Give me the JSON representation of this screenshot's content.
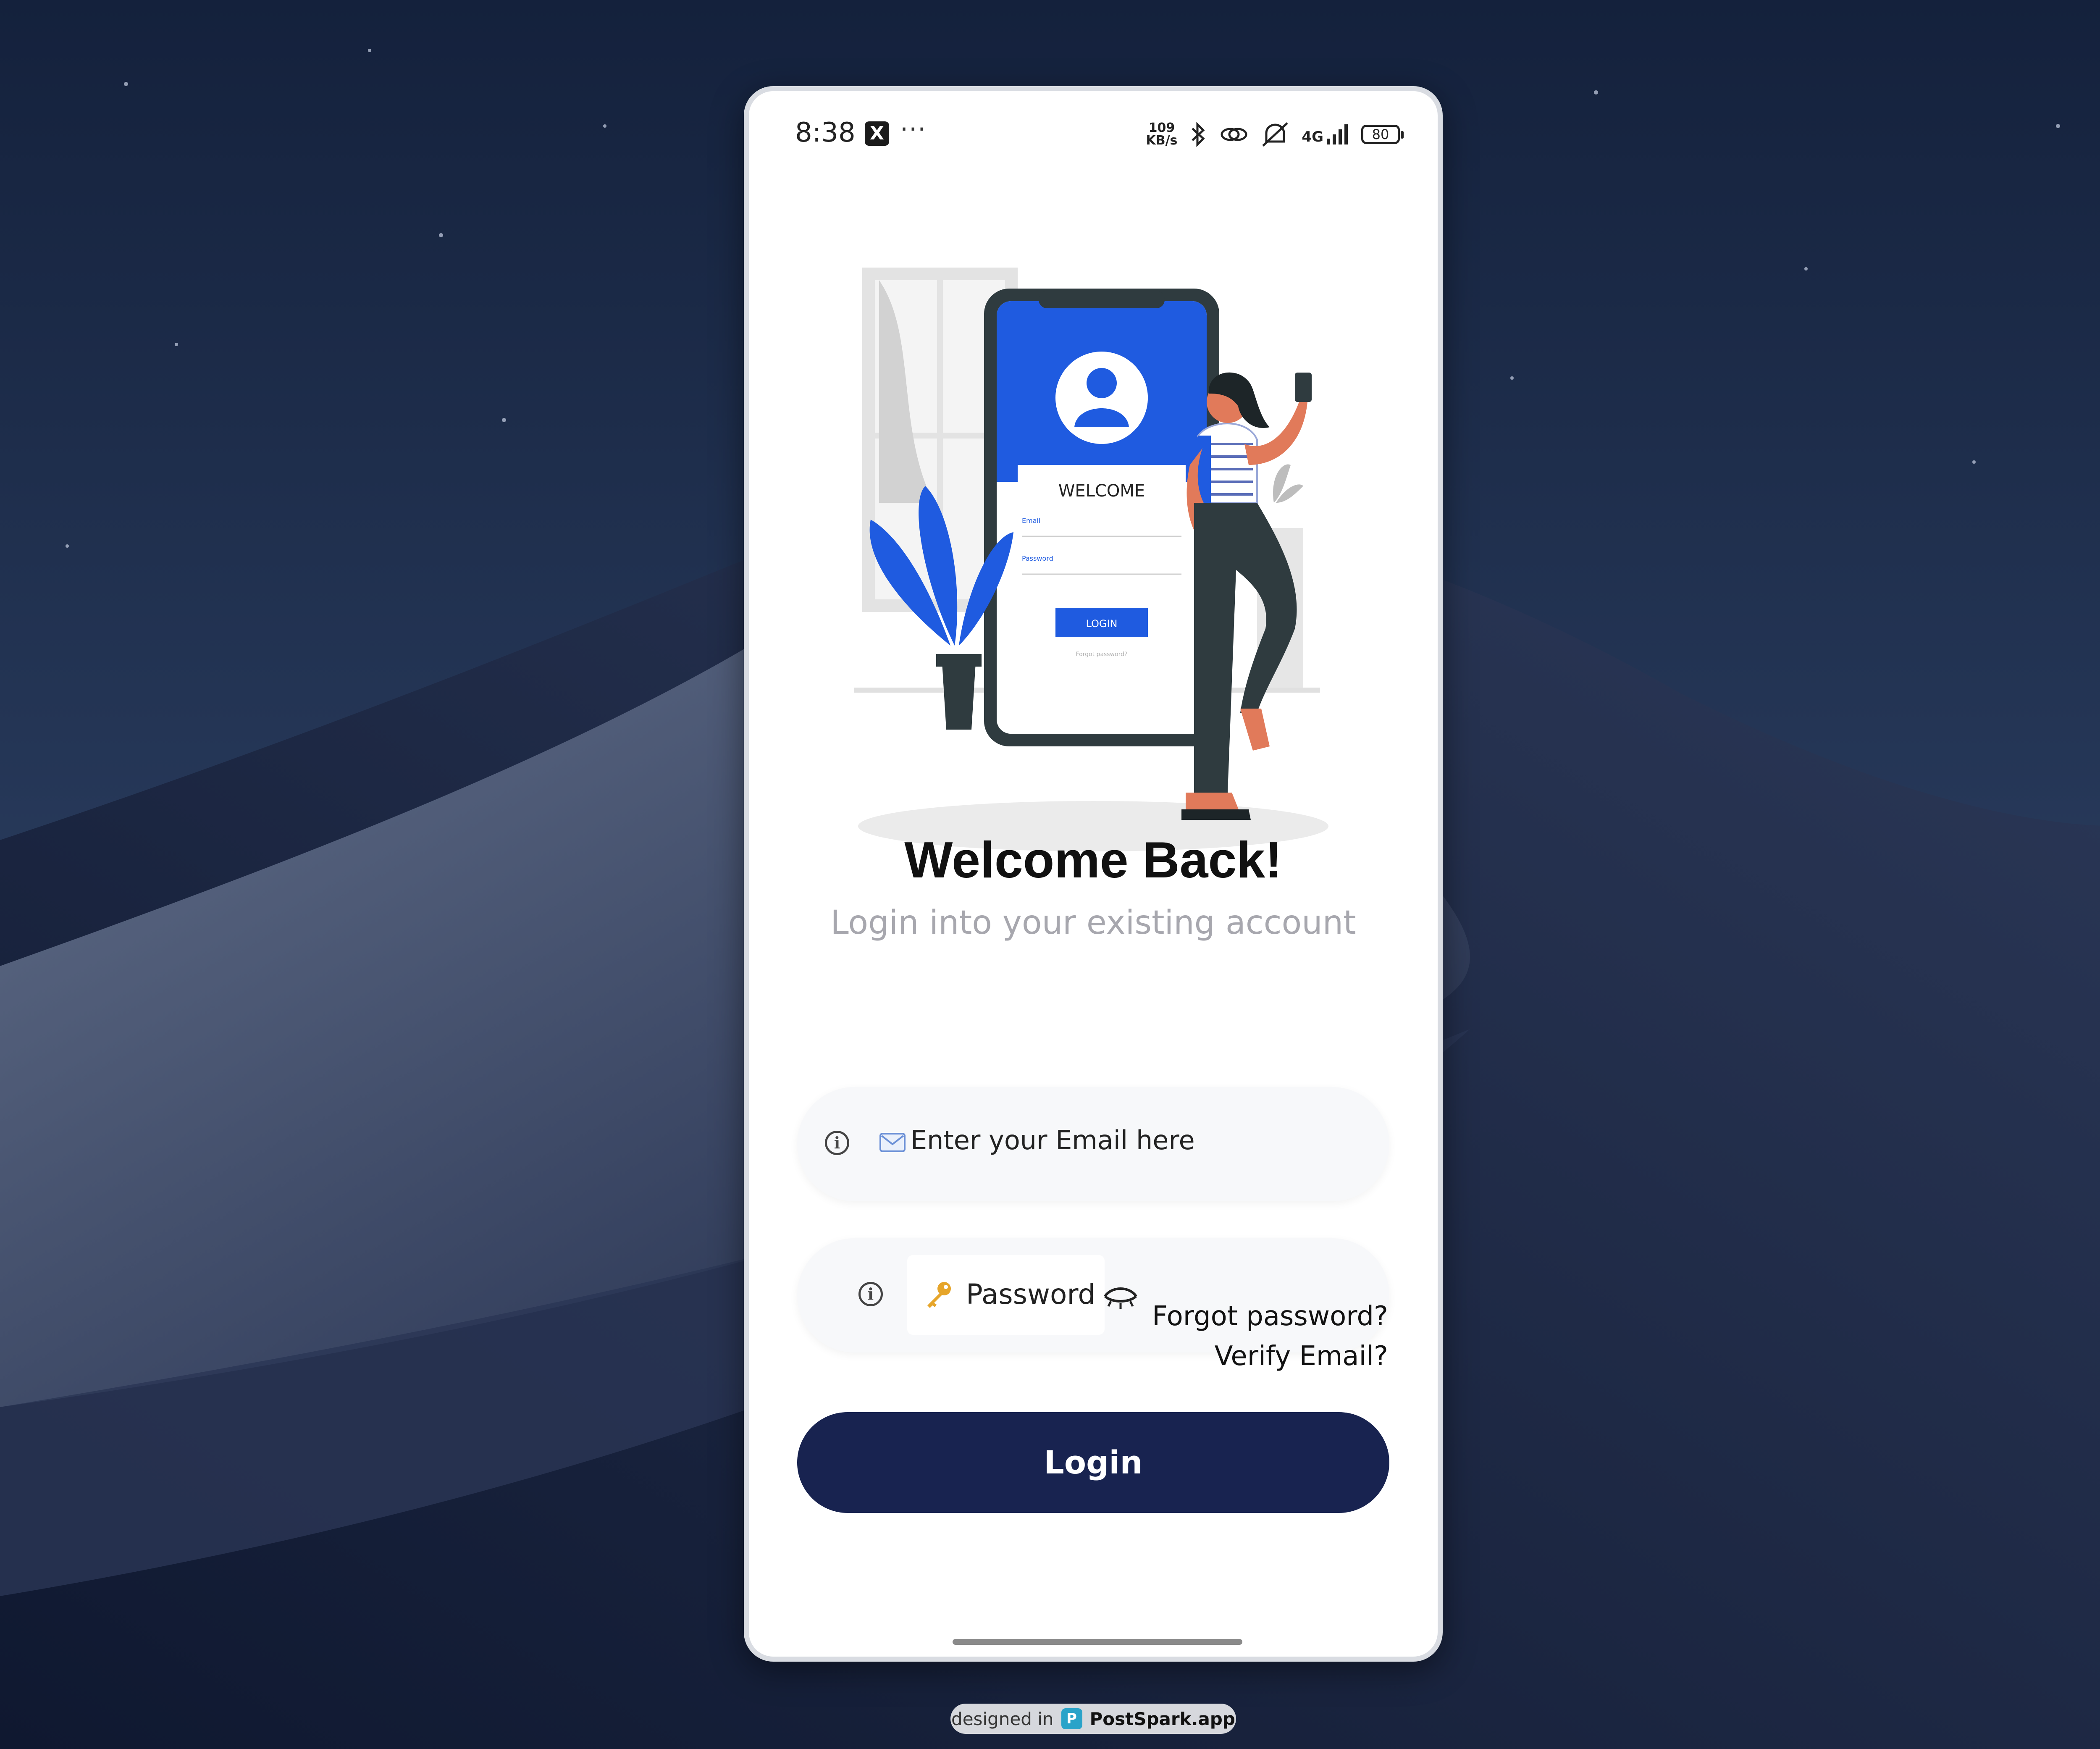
{
  "status_bar": {
    "time": "8:38",
    "app_icon_letter": "X",
    "more_indicator": "···",
    "network_speed_value": "109",
    "network_speed_unit": "KB/s",
    "network_type": "4G",
    "battery_level": "80",
    "icons": [
      "x-app-icon",
      "bluetooth-icon",
      "link-icon",
      "mute-icon",
      "signal-icon",
      "battery-icon"
    ]
  },
  "illustration": {
    "screen_title": "WELCOME",
    "screen_email_label": "Email",
    "screen_password_label": "Password",
    "screen_login_label": "LOGIN",
    "screen_forgot_label": "Forgot password?"
  },
  "header": {
    "title": "Welcome Back!",
    "subtitle": "Login into your existing account"
  },
  "form": {
    "email_prefix_icon": "email-icon",
    "email_text": "Enter your Email here",
    "password_prefix_icon": "key-icon",
    "password_text": "Password",
    "forgot_password": "Forgot password?",
    "verify_email": "Verify Email?",
    "login_button": "Login"
  },
  "footer_badge": {
    "prefix": "designed in",
    "brand": "PostSpark.app"
  },
  "colors": {
    "primary_button": "#182350",
    "illustration_blue": "#1f5be0",
    "subtitle_gray": "#a7a7ae",
    "field_background": "#f7f8fa",
    "skin": "#e17a5a"
  }
}
